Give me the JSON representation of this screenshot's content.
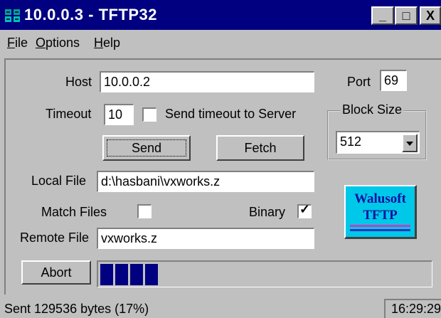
{
  "window": {
    "title": "10.0.0.3 - TFTP32",
    "controls": {
      "minimize": "_",
      "maximize": "□",
      "close": "X"
    }
  },
  "menu": {
    "items": [
      {
        "label": "File",
        "accel": "F",
        "rest": "ile"
      },
      {
        "label": "Options",
        "accel": "O",
        "rest": "ptions"
      },
      {
        "label": "Help",
        "accel": "H",
        "rest": "elp"
      }
    ]
  },
  "form": {
    "host_label": "Host",
    "host_value": "10.0.0.2",
    "port_label": "Port",
    "port_value": "69",
    "timeout_label": "Timeout",
    "timeout_value": "10",
    "send_timeout_label": "Send timeout to Server",
    "send_timeout_checked": false,
    "block_size_label": "Block Size",
    "block_size_value": "512",
    "send_button": "Send",
    "fetch_button": "Fetch",
    "local_file_label": "Local File",
    "local_file_value": "d:\\hasbani\\vxworks.z",
    "match_files_label": "Match Files",
    "match_files_checked": false,
    "binary_label": "Binary",
    "binary_checked": true,
    "remote_file_label": "Remote File",
    "remote_file_value": "vxworks.z",
    "abort_button": "Abort",
    "progress_percent": 17
  },
  "logo": {
    "line1": "Walusoft",
    "line2": "TFTP"
  },
  "status": {
    "message": "Sent 129536 bytes (17%)",
    "time": "16:29:29"
  },
  "colors": {
    "titlebar": "#000080",
    "face": "#c0c0c0",
    "progress": "#000080",
    "logo_bg": "#00c8e8",
    "logo_text": "#1010a0"
  }
}
